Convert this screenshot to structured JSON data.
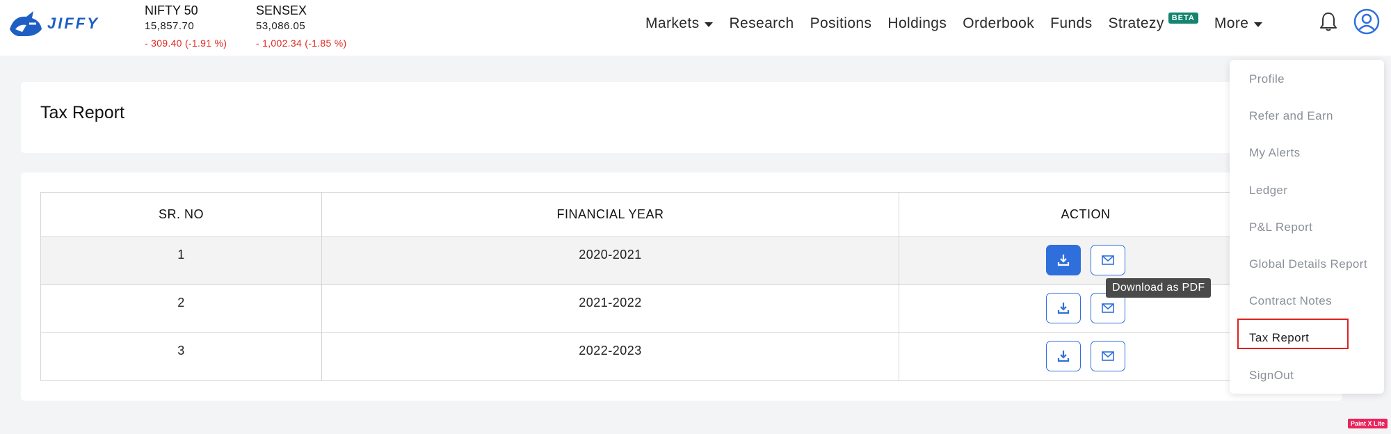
{
  "brand": {
    "name": "JIFFY"
  },
  "indices": [
    {
      "name": "NIFTY 50",
      "value": "15,857.70",
      "change": "- 309.40 (-1.91 %)"
    },
    {
      "name": "SENSEX",
      "value": "53,086.05",
      "change": "- 1,002.34 (-1.85 %)"
    }
  ],
  "nav": {
    "markets": "Markets",
    "research": "Research",
    "positions": "Positions",
    "holdings": "Holdings",
    "orderbook": "Orderbook",
    "funds": "Funds",
    "stratezy": "Stratezy",
    "beta": "BETA",
    "more": "More"
  },
  "page": {
    "title": "Tax Report"
  },
  "table": {
    "headers": [
      "SR. NO",
      "FINANCIAL YEAR",
      "ACTION"
    ],
    "rows": [
      {
        "sr": "1",
        "year": "2020-2021"
      },
      {
        "sr": "2",
        "year": "2021-2022"
      },
      {
        "sr": "3",
        "year": "2022-2023"
      }
    ]
  },
  "tooltip": "Download as PDF",
  "menu": {
    "items": [
      "Profile",
      "Refer and Earn",
      "My Alerts",
      "Ledger",
      "P&L Report",
      "Global Details Report",
      "Contract Notes",
      "Tax Report",
      "SignOut"
    ],
    "active": "Tax Report"
  },
  "watermark": "Paint X Lite",
  "colors": {
    "brand": "#1f5fc4",
    "accent": "#2f6fdc",
    "negative": "#e0281e",
    "beta": "#12846f",
    "highlight": "#e02020"
  },
  "icons": [
    "jiffy-logo-icon",
    "chevron-down-icon",
    "bell-icon",
    "user-avatar-icon",
    "download-icon",
    "mail-icon"
  ]
}
